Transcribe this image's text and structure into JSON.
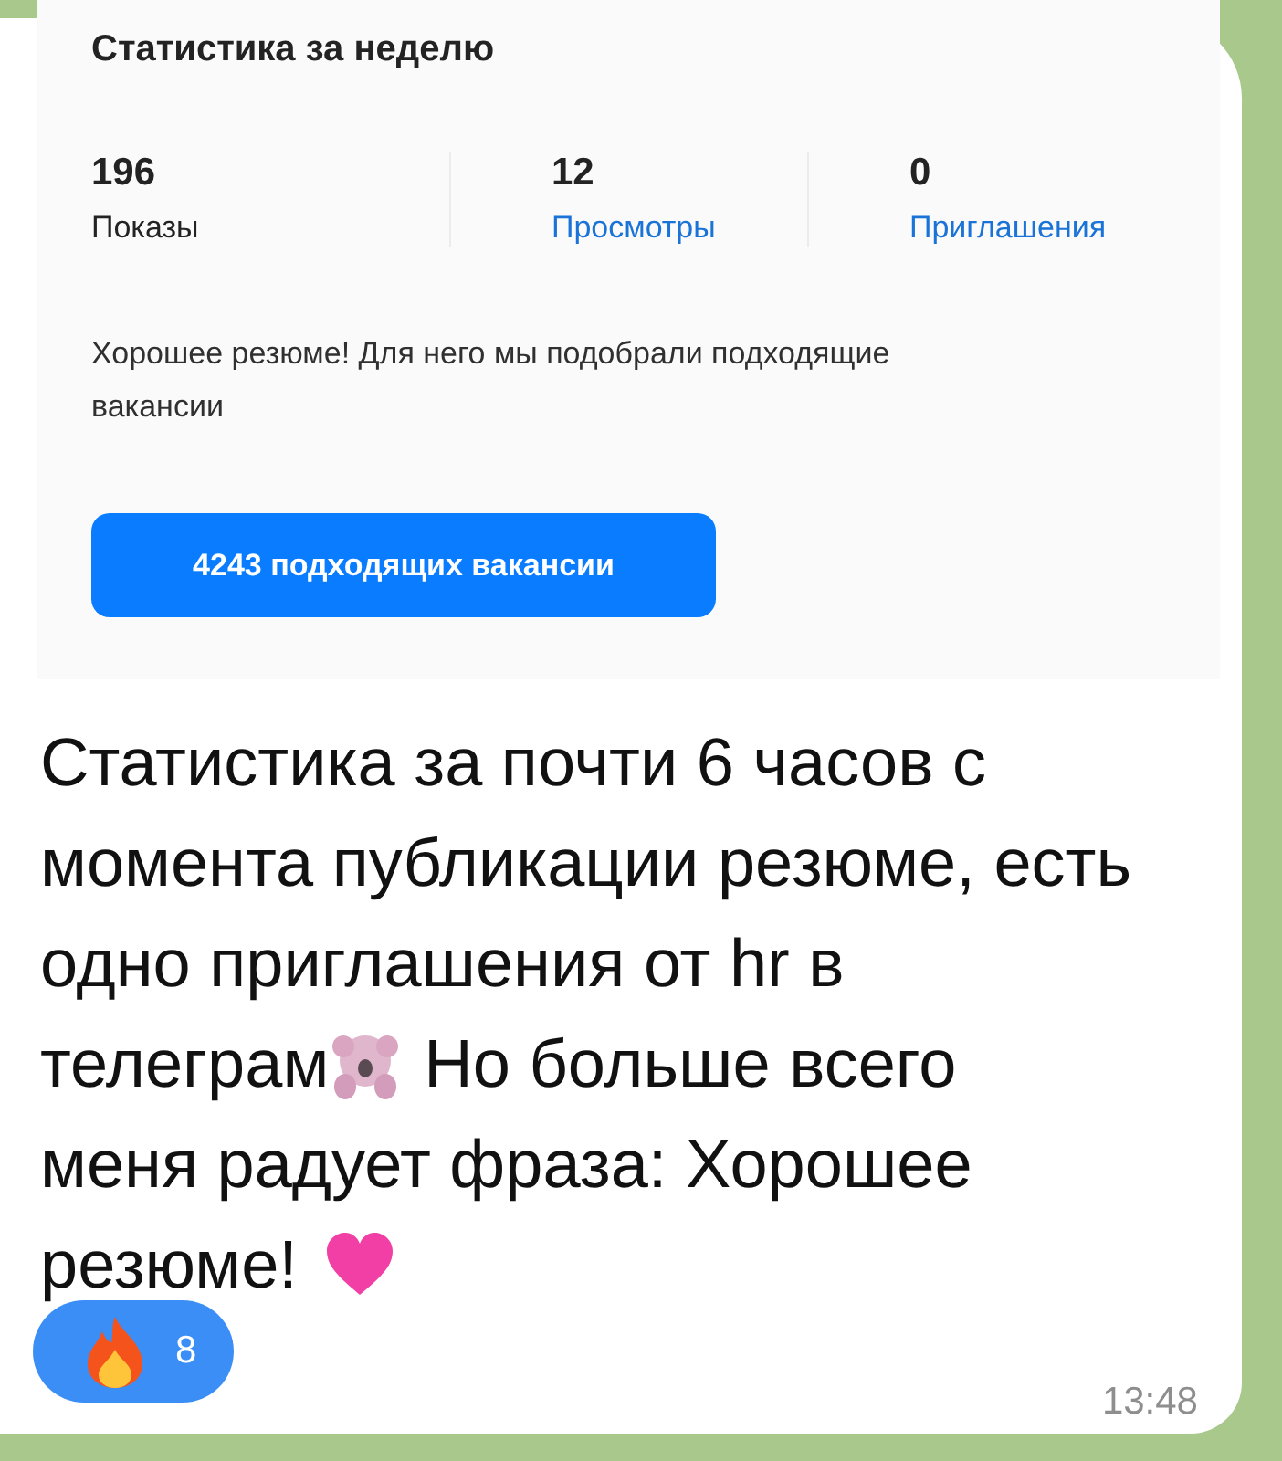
{
  "embedded_screenshot": {
    "title": "Статистика за неделю",
    "stats": [
      {
        "value": "196",
        "label": "Показы",
        "link": false
      },
      {
        "value": "12",
        "label": "Просмотры",
        "link": true
      },
      {
        "value": "0",
        "label": "Приглашения",
        "link": true
      }
    ],
    "description": "Хорошее резюме! Для него мы подобрали подходящие вакансии",
    "button": "4243 подходящих вакансии"
  },
  "message": {
    "lines": [
      [
        {
          "kind": "text",
          "text": "Статистика за почти 6 часов с"
        }
      ],
      [
        {
          "kind": "text",
          "text": "момента публикации резюме, есть"
        }
      ],
      [
        {
          "kind": "text",
          "text": "одно приглашения от hr в"
        }
      ],
      [
        {
          "kind": "text",
          "text": "телеграм"
        },
        {
          "kind": "koala"
        },
        {
          "kind": "text",
          "text": "Но больше всего"
        }
      ],
      [
        {
          "kind": "text",
          "text": "меня радует фраза: Хорошее"
        }
      ],
      [
        {
          "kind": "text",
          "text": "резюме!"
        },
        {
          "kind": "heart"
        }
      ]
    ],
    "reaction": {
      "count": "8"
    },
    "time": "13:48"
  }
}
